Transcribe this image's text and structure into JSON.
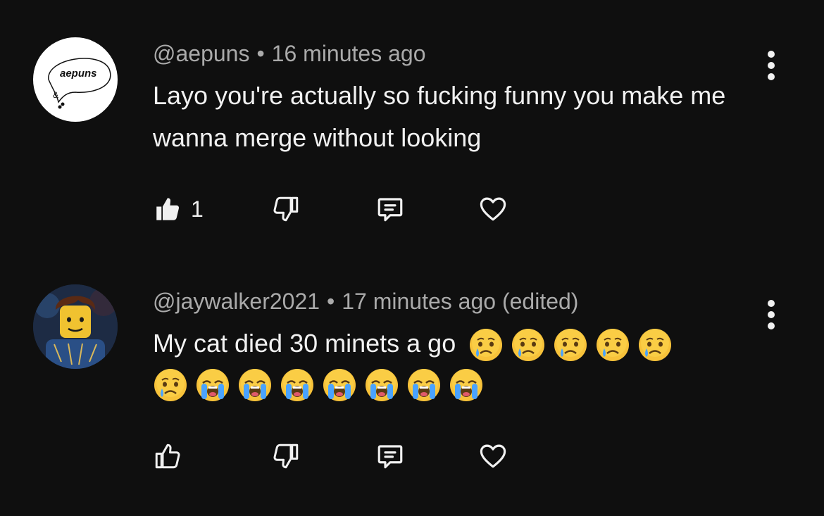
{
  "comments": [
    {
      "handle": "@aepuns",
      "separator": "•",
      "time": "16 minutes ago",
      "text": "Layo you're actually so fucking funny you make me wanna merge without looking",
      "avatar_label": "aepuns",
      "avatar_mark": "&",
      "likes": "1",
      "liked": true
    },
    {
      "handle": "@jaywalker2021",
      "separator": "•",
      "time": "17 minutes ago (edited)",
      "text": "My cat died 30 minets a go",
      "emojis_line1": [
        "crying-face",
        "crying-face",
        "crying-face",
        "crying-face",
        "crying-face"
      ],
      "emojis_line2": [
        "crying-face",
        "loudly-crying-face",
        "loudly-crying-face",
        "loudly-crying-face",
        "loudly-crying-face",
        "loudly-crying-face",
        "loudly-crying-face",
        "loudly-crying-face"
      ],
      "liked": false
    }
  ],
  "colors": {
    "background": "#0f0f0f",
    "meta": "#aaaaaa",
    "text": "#f1f1f1",
    "emoji_yellow": "#f7c23a"
  }
}
